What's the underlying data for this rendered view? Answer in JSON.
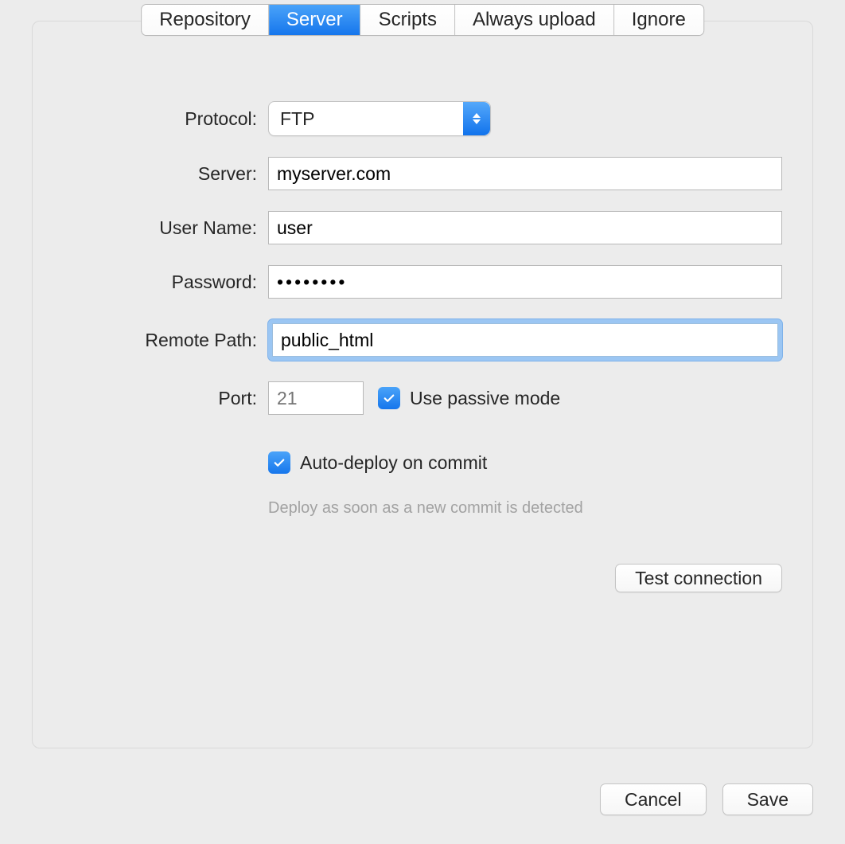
{
  "tabs": [
    {
      "label": "Repository",
      "active": false
    },
    {
      "label": "Server",
      "active": true
    },
    {
      "label": "Scripts",
      "active": false
    },
    {
      "label": "Always upload",
      "active": false
    },
    {
      "label": "Ignore",
      "active": false
    }
  ],
  "form": {
    "protocol": {
      "label": "Protocol:",
      "value": "FTP"
    },
    "server": {
      "label": "Server:",
      "value": "myserver.com"
    },
    "username": {
      "label": "User Name:",
      "value": "user"
    },
    "password": {
      "label": "Password:",
      "value": "••••••••"
    },
    "remotepath": {
      "label": "Remote Path:",
      "value": "public_html"
    },
    "port": {
      "label": "Port:",
      "placeholder": "21"
    },
    "passive": {
      "label": "Use passive mode",
      "checked": true
    },
    "autodeploy": {
      "label": "Auto-deploy on commit",
      "checked": true,
      "hint": "Deploy as soon as a new commit is detected"
    }
  },
  "buttons": {
    "test": "Test connection",
    "cancel": "Cancel",
    "save": "Save"
  }
}
